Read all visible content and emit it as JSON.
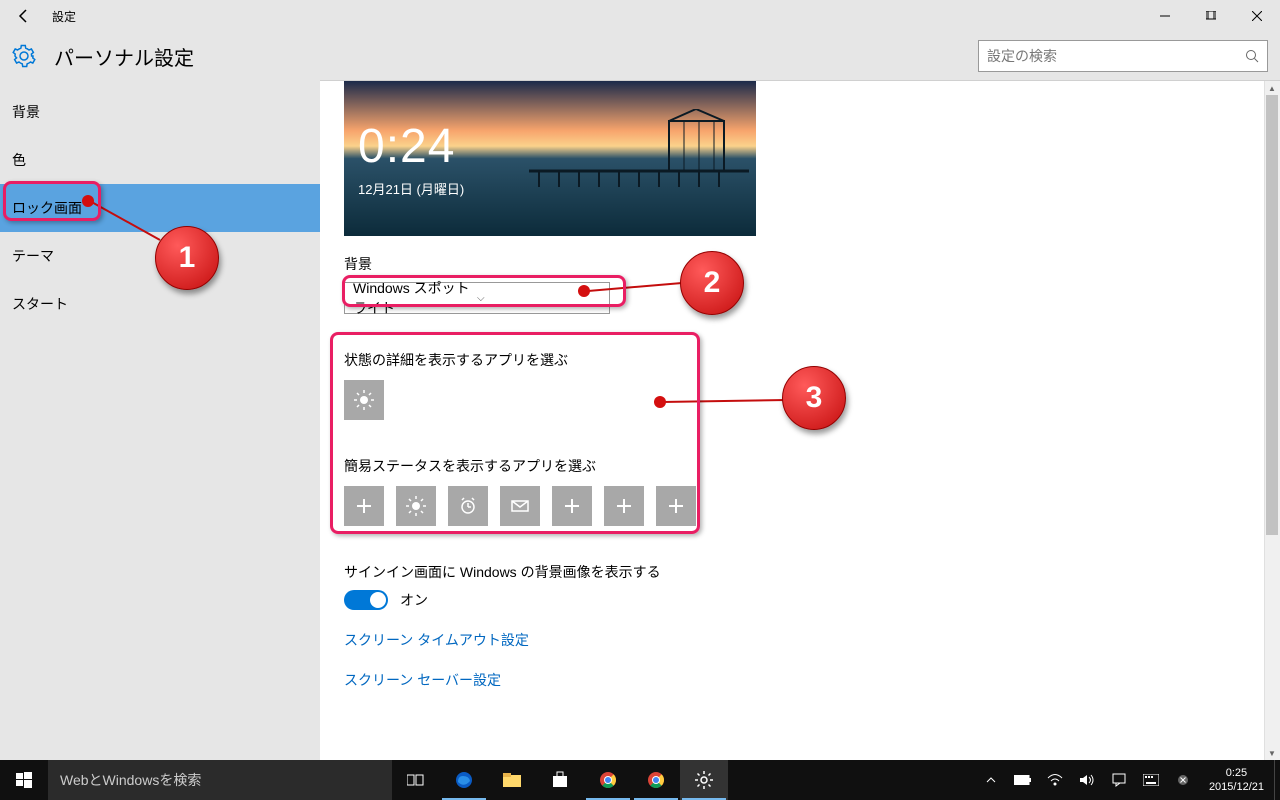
{
  "window": {
    "title": "設定"
  },
  "header": {
    "page_title": "パーソナル設定",
    "search_placeholder": "設定の検索"
  },
  "sidebar": {
    "items": [
      {
        "label": "背景"
      },
      {
        "label": "色"
      },
      {
        "label": "ロック画面"
      },
      {
        "label": "テーマ"
      },
      {
        "label": "スタート"
      }
    ],
    "selected_index": 2
  },
  "content": {
    "preview": {
      "time": "0:24",
      "date": "12月21日 (月曜日)"
    },
    "bg_label": "背景",
    "bg_dropdown": "Windows スポットライト",
    "detailed_label": "状態の詳細を表示するアプリを選ぶ",
    "quick_label": "簡易ステータスを表示するアプリを選ぶ",
    "signin_label": "サインイン画面に Windows の背景画像を表示する",
    "toggle_state": "オン",
    "link_timeout": "スクリーン タイムアウト設定",
    "link_saver": "スクリーン セーバー設定",
    "quick_tiles": [
      "plus",
      "weather",
      "alarm",
      "mail",
      "plus",
      "plus",
      "plus"
    ]
  },
  "annotations": {
    "c1": "1",
    "c2": "2",
    "c3": "3"
  },
  "taskbar": {
    "search_placeholder": "WebとWindowsを検索",
    "time": "0:25",
    "date": "2015/12/21"
  }
}
